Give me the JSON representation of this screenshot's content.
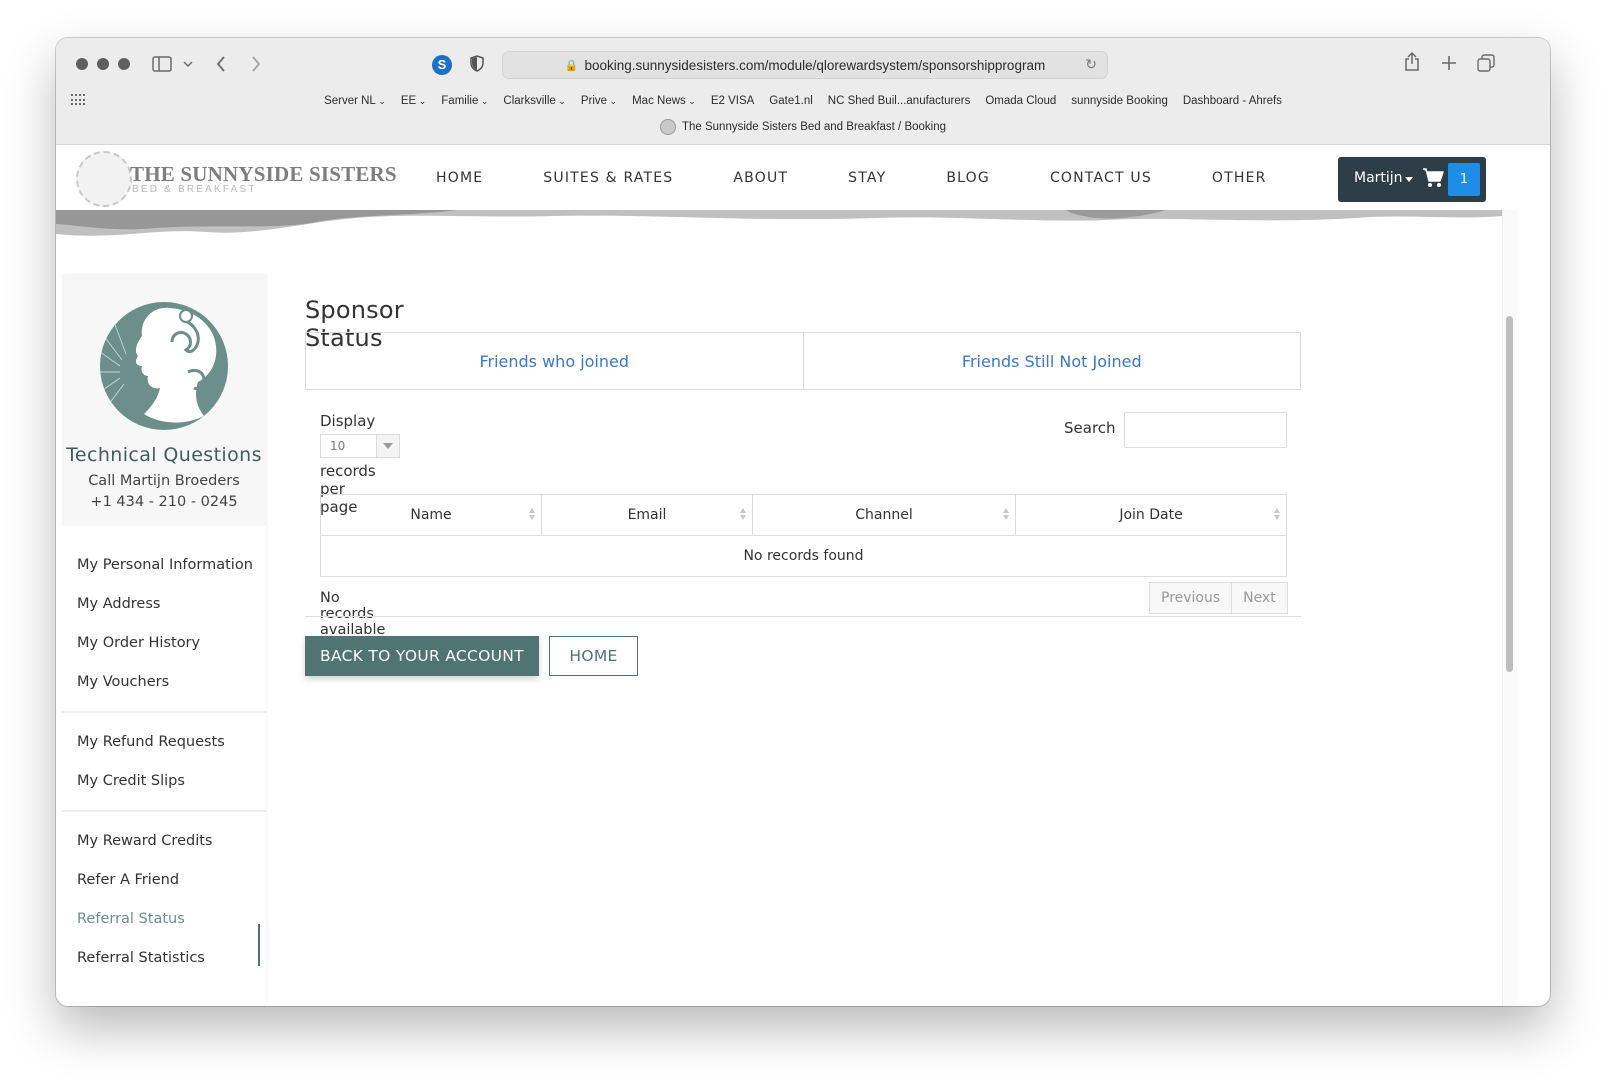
{
  "browser": {
    "url": "booking.sunnysidesisters.com/module/qlorewardsystem/sponsorshipprogram",
    "tab_title": "The Sunnyside Sisters Bed and Breakfast / Booking",
    "bookmarks": [
      {
        "label": "Server NL",
        "dropdown": true
      },
      {
        "label": "EE",
        "dropdown": true
      },
      {
        "label": "Familie",
        "dropdown": true
      },
      {
        "label": "Clarksville",
        "dropdown": true
      },
      {
        "label": "Prive",
        "dropdown": true
      },
      {
        "label": "Mac News",
        "dropdown": true
      },
      {
        "label": "E2 VISA",
        "dropdown": false
      },
      {
        "label": "Gate1.nl",
        "dropdown": false
      },
      {
        "label": "NC Shed Buil...anufacturers",
        "dropdown": false
      },
      {
        "label": "Omada Cloud",
        "dropdown": false
      },
      {
        "label": "sunnyside Booking",
        "dropdown": false
      },
      {
        "label": "Dashboard - Ahrefs",
        "dropdown": false
      }
    ],
    "extension_s": "S"
  },
  "site": {
    "logo_title": "THE SUNNYSIDE SISTERS",
    "logo_subtitle": "BED & BREAKFAST",
    "nav": [
      "HOME",
      "SUITES & RATES",
      "ABOUT",
      "STAY",
      "BLOG",
      "CONTACT US",
      "OTHER"
    ],
    "user_name": "Martijn",
    "cart_count": "1",
    "colors": {
      "accent": "#4f7472",
      "link": "#3a78c9",
      "dark": "#2e3e49",
      "badge": "#1c8ee8"
    }
  },
  "sidebar": {
    "title": "Technical Questions",
    "line1": "Call Martijn Broeders",
    "line2": "+1 434 - 210 - 0245",
    "groups": [
      [
        "My Personal Information",
        "My Address",
        "My Order History",
        "My Vouchers"
      ],
      [
        "My Refund Requests",
        "My Credit Slips"
      ],
      [
        "My Reward Credits",
        "Refer A Friend",
        "Referral Status",
        "Referral Statistics"
      ]
    ],
    "active": "Referral Status"
  },
  "main": {
    "title": "Sponsor Status",
    "tabs": [
      "Friends who joined",
      "Friends Still Not Joined"
    ],
    "display_label": "Display",
    "page_size": "10",
    "per_page_label": "records per page",
    "search_label": "Search",
    "search_value": "",
    "columns": [
      "Name",
      "Email",
      "Channel",
      "Join Date"
    ],
    "empty_row": "No records found",
    "info": "No records available",
    "prev_label": "Previous",
    "next_label": "Next",
    "back_button": "BACK TO YOUR ACCOUNT",
    "home_button": "HOME"
  }
}
